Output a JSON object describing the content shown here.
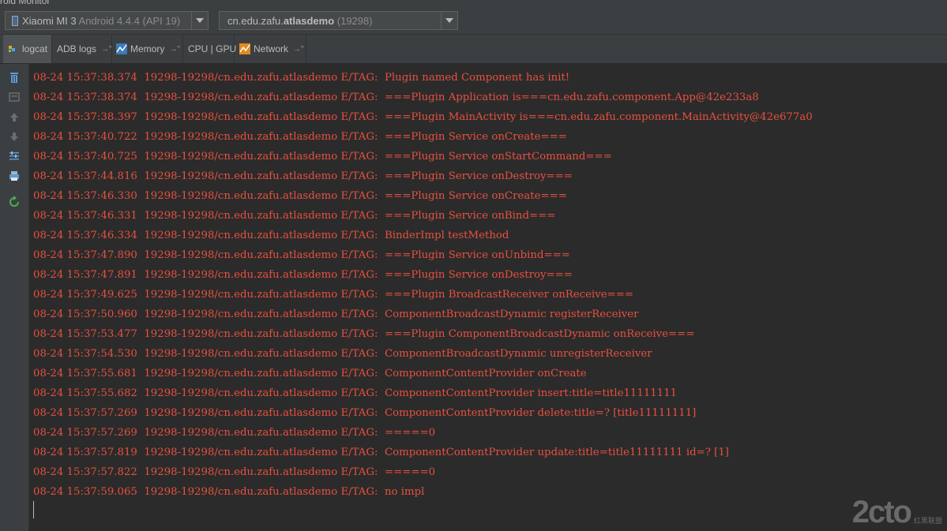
{
  "window": {
    "title": "roid Monitor"
  },
  "device_selector": {
    "device_name": "Xiaomi MI 3",
    "device_detail": "Android 4.4.4 (API 19)"
  },
  "process_selector": {
    "package_prefix": "cn.edu.zafu.",
    "package_bold": "atlasdemo",
    "pid": "(19298)"
  },
  "tabs": [
    {
      "label": "logcat",
      "icon": "logcat-icon",
      "active": true
    },
    {
      "label": "ADB logs",
      "icon": "",
      "active": false
    },
    {
      "label": "Memory",
      "icon": "memory-chart-icon",
      "active": false
    },
    {
      "label": "CPU | GPU",
      "icon": "",
      "active": false
    },
    {
      "label": "Network",
      "icon": "network-chart-icon",
      "active": false
    }
  ],
  "tab_pin_glyph": "→\"",
  "toolbar_icons": [
    "trash-icon",
    "soft-wrap-icon",
    "up-arrow-icon",
    "down-arrow-icon",
    "filter-settings-icon",
    "print-icon",
    "restart-icon"
  ],
  "log_color": "#e8503f",
  "log_lines": [
    "08-24 15:37:38.374  19298-19298/cn.edu.zafu.atlasdemo E/TAG:  Plugin named Component has init!",
    "08-24 15:37:38.374  19298-19298/cn.edu.zafu.atlasdemo E/TAG:  ===Plugin Application is===cn.edu.zafu.component.App@42e233a8",
    "08-24 15:37:38.397  19298-19298/cn.edu.zafu.atlasdemo E/TAG:  ===Plugin MainActivity is===cn.edu.zafu.component.MainActivity@42e677a0",
    "08-24 15:37:40.722  19298-19298/cn.edu.zafu.atlasdemo E/TAG:  ===Plugin Service onCreate===",
    "08-24 15:37:40.725  19298-19298/cn.edu.zafu.atlasdemo E/TAG:  ===Plugin Service onStartCommand===",
    "08-24 15:37:44.816  19298-19298/cn.edu.zafu.atlasdemo E/TAG:  ===Plugin Service onDestroy===",
    "08-24 15:37:46.330  19298-19298/cn.edu.zafu.atlasdemo E/TAG:  ===Plugin Service onCreate===",
    "08-24 15:37:46.331  19298-19298/cn.edu.zafu.atlasdemo E/TAG:  ===Plugin Service onBind===",
    "08-24 15:37:46.334  19298-19298/cn.edu.zafu.atlasdemo E/TAG:  BinderImpl testMethod",
    "08-24 15:37:47.890  19298-19298/cn.edu.zafu.atlasdemo E/TAG:  ===Plugin Service onUnbind===",
    "08-24 15:37:47.891  19298-19298/cn.edu.zafu.atlasdemo E/TAG:  ===Plugin Service onDestroy===",
    "08-24 15:37:49.625  19298-19298/cn.edu.zafu.atlasdemo E/TAG:  ===Plugin BroadcastReceiver onReceive===",
    "08-24 15:37:50.960  19298-19298/cn.edu.zafu.atlasdemo E/TAG:  ComponentBroadcastDynamic registerReceiver",
    "08-24 15:37:53.477  19298-19298/cn.edu.zafu.atlasdemo E/TAG:  ===Plugin ComponentBroadcastDynamic onReceive===",
    "08-24 15:37:54.530  19298-19298/cn.edu.zafu.atlasdemo E/TAG:  ComponentBroadcastDynamic unregisterReceiver",
    "08-24 15:37:55.681  19298-19298/cn.edu.zafu.atlasdemo E/TAG:  ComponentContentProvider onCreate",
    "08-24 15:37:55.682  19298-19298/cn.edu.zafu.atlasdemo E/TAG:  ComponentContentProvider insert:title=title11111111",
    "08-24 15:37:57.269  19298-19298/cn.edu.zafu.atlasdemo E/TAG:  ComponentContentProvider delete:title=? [title11111111]",
    "08-24 15:37:57.269  19298-19298/cn.edu.zafu.atlasdemo E/TAG:  =====0",
    "08-24 15:37:57.819  19298-19298/cn.edu.zafu.atlasdemo E/TAG:  ComponentContentProvider update:title=title11111111 id=? [1]",
    "08-24 15:37:57.822  19298-19298/cn.edu.zafu.atlasdemo E/TAG:  =====0",
    "08-24 15:37:59.065  19298-19298/cn.edu.zafu.atlasdemo E/TAG:  no impl"
  ],
  "watermark": {
    "big": "2cto",
    "small": "红黑联盟"
  }
}
